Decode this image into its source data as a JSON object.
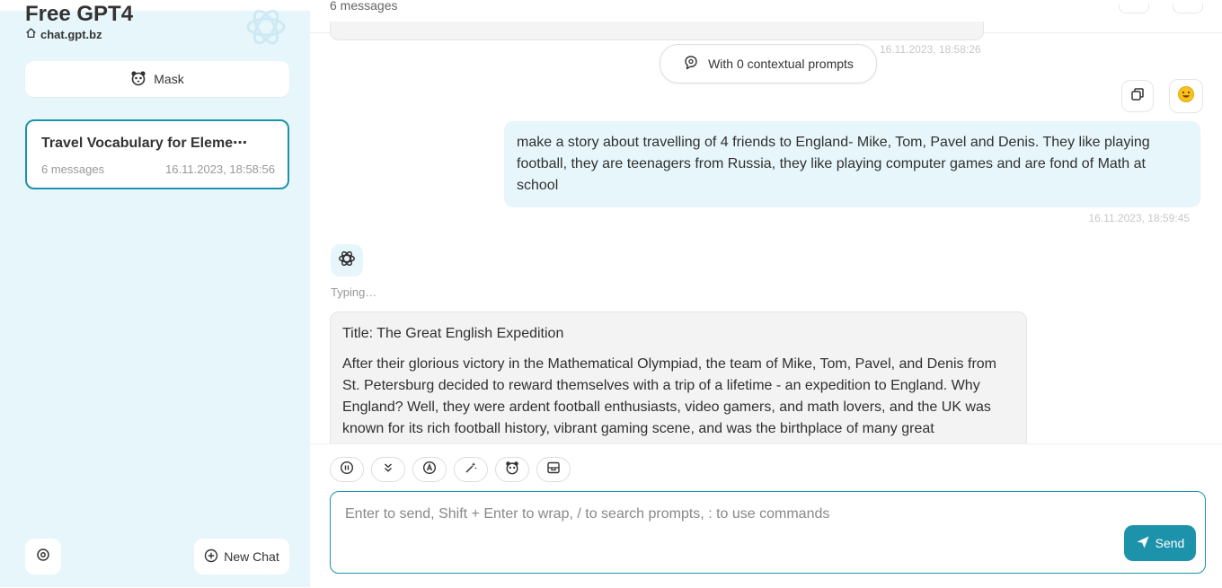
{
  "sidebar": {
    "title": "Free GPT4",
    "site": "chat.gpt.bz",
    "mask_label": "Mask",
    "chats": [
      {
        "title": "Travel Vocabulary for Eleme⋯",
        "count": "6 messages",
        "date": "16.11.2023, 18:58:56"
      }
    ],
    "new_chat_label": "New Chat"
  },
  "header": {
    "subtitle": "6 messages"
  },
  "chat": {
    "prev_date": "16.11.2023, 18:58:26",
    "context_label": "With 0 contextual prompts",
    "user_message": "make a story about travelling of 4 friends to England- Mike, Tom, Pavel and Denis. They like playing football, they are teenagers from Russia, they like playing computer games and are fond of Math at school",
    "user_date": "16.11.2023, 18:59:45",
    "typing_label": "Typing…",
    "bot_title": "Title: The Great English Expedition",
    "bot_paragraph": "After their glorious victory in the Mathematical Olympiad, the team of Mike, Tom, Pavel, and Denis from St. Petersburg decided to reward themselves with a trip of a lifetime - an expedition to England. Why England? Well, they were ardent football enthusiasts, video gamers, and math lovers, and the UK was known for its rich football history, vibrant gaming scene, and was the birthplace of many great"
  },
  "input": {
    "placeholder": "Enter to send, Shift + Enter to wrap, / to search prompts, : to use commands",
    "send_label": "Send"
  },
  "colors": {
    "accent": "#1d93ab",
    "sidebar_bg": "#e7f6fb",
    "user_bubble": "#e7f6fb",
    "bot_bubble": "#f3f3f3"
  },
  "icons": [
    "chatgpt-logo-icon",
    "home-icon",
    "mask-icon",
    "settings-icon",
    "plus-circle-icon",
    "brain-icon",
    "copy-icon",
    "emoji-icon",
    "pause-icon",
    "chevrons-down-icon",
    "a-circle-icon",
    "magic-wand-icon",
    "bear-icon",
    "layout-icon",
    "send-icon"
  ]
}
